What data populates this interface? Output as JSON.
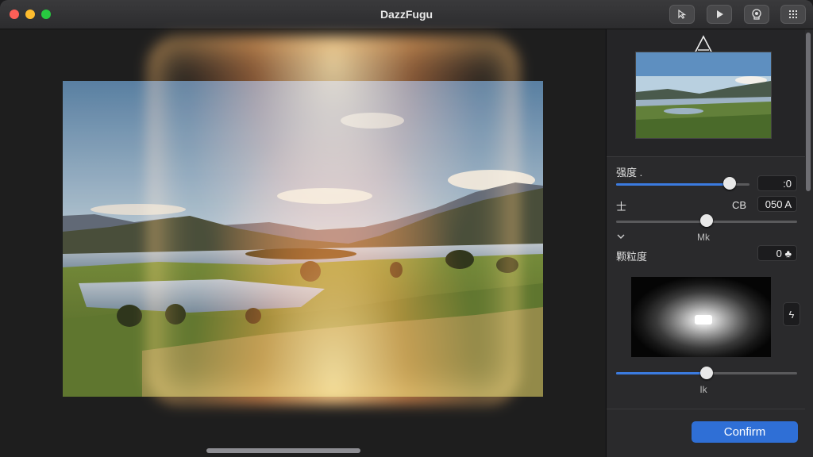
{
  "window": {
    "title": "DazzFugu"
  },
  "toolbar": {
    "buttons": [
      {
        "icon": "select-arrow-icon"
      },
      {
        "icon": "play-icon"
      },
      {
        "icon": "lens-icon"
      },
      {
        "icon": "grid-icon"
      }
    ]
  },
  "panel": {
    "sliders": [
      {
        "label": "强度 .",
        "value": ":0",
        "level": 0.85
      },
      {
        "label": "士",
        "unit": "CB",
        "value": "050 A",
        "caption": "Mk",
        "level": 0.5
      }
    ],
    "grain": {
      "label": "颗粒度",
      "value": "0 ♣",
      "caption": "Ik",
      "level": 0.5
    },
    "expand_icon": "chevron-down-icon",
    "side_button_glyph": "ϟ",
    "confirm_label": "Confirm"
  },
  "colors": {
    "accent": "#3b7be0",
    "button": "#2f6fd6",
    "panel": "#2a2a2c"
  }
}
